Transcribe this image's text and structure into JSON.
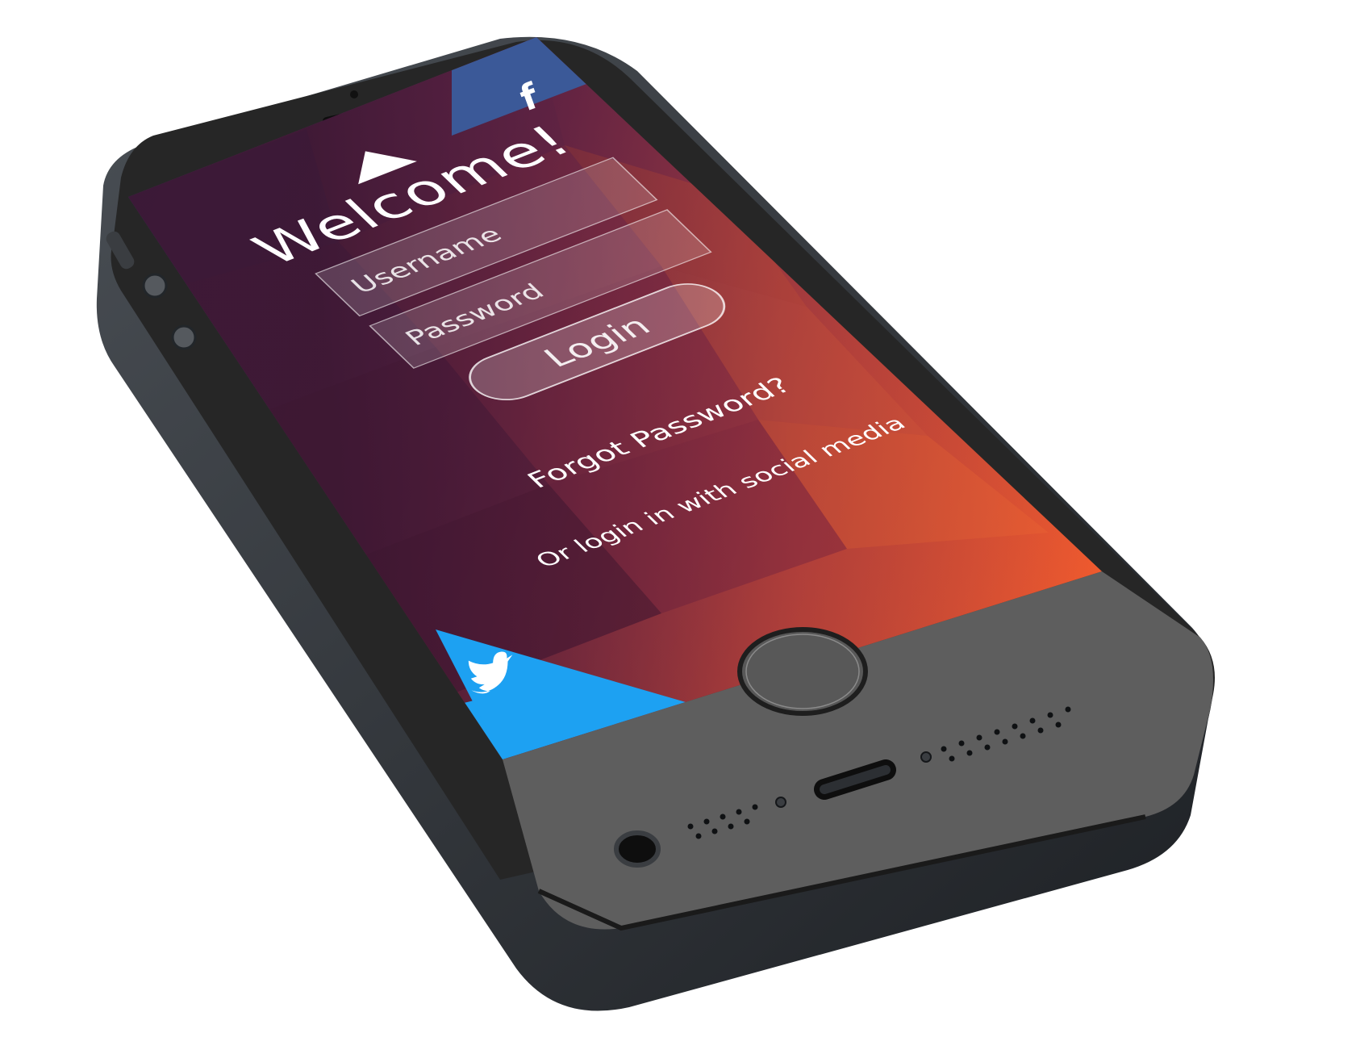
{
  "screen": {
    "title": "Welcome!",
    "username_placeholder": "Username",
    "password_placeholder": "Password",
    "login_label": "Login",
    "forgot_password": "Forgot Password?",
    "social_label": "Or login in with social media"
  },
  "icons": {
    "logo": "triangle-logo-icon",
    "facebook": "facebook-icon",
    "twitter": "twitter-icon"
  },
  "colors": {
    "facebook": "#3b5998",
    "twitter": "#1da1f2",
    "bezel_top": "#262626",
    "bezel_bottom": "#5e5e5e",
    "body": "#2b2f33"
  }
}
